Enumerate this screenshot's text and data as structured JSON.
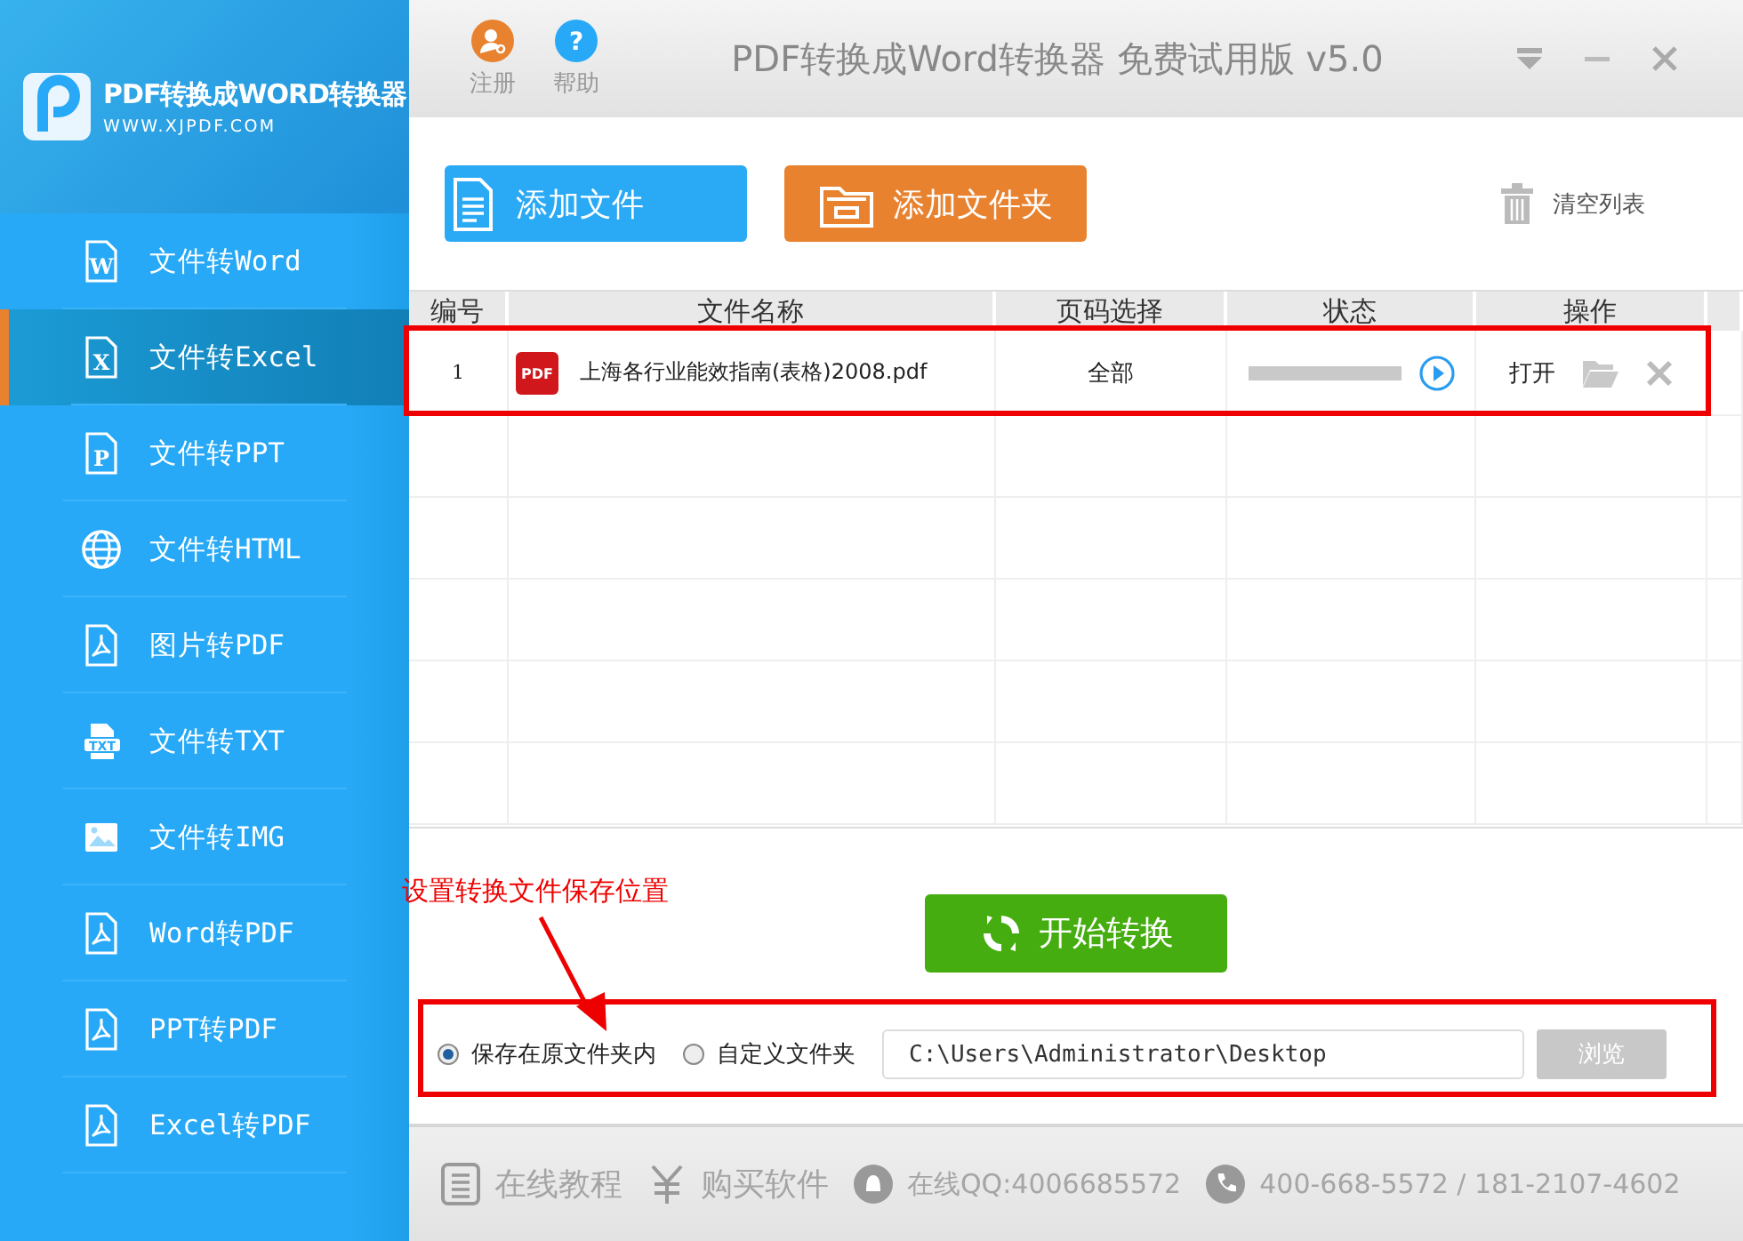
{
  "logo": {
    "title": "PDF转换成WORD转换器",
    "url": "WWW.XJPDF.COM"
  },
  "sidebar": {
    "items": [
      {
        "label": "文件转Word",
        "kind": "word",
        "icon": "W",
        "selected": false
      },
      {
        "label": "文件转Excel",
        "kind": "excel",
        "icon": "X",
        "selected": true
      },
      {
        "label": "文件转PPT",
        "kind": "ppt",
        "icon": "P",
        "selected": false
      },
      {
        "label": "文件转HTML",
        "kind": "html",
        "selected": false
      },
      {
        "label": "图片转PDF",
        "kind": "pdf",
        "selected": false
      },
      {
        "label": "文件转TXT",
        "kind": "txt",
        "icon": "TXT",
        "selected": false
      },
      {
        "label": "文件转IMG",
        "kind": "img",
        "selected": false
      },
      {
        "label": "Word转PDF",
        "kind": "pdf",
        "selected": false
      },
      {
        "label": "PPT转PDF",
        "kind": "pdf",
        "selected": false
      },
      {
        "label": "Excel转PDF",
        "kind": "pdf",
        "selected": false
      }
    ]
  },
  "header": {
    "tools": [
      {
        "label": "注册",
        "kind": "register"
      },
      {
        "label": "帮助",
        "kind": "help",
        "icon": "?"
      }
    ],
    "title": "PDF转换成Word转换器 免费试用版 v5.0"
  },
  "toolbar": {
    "buttons": [
      {
        "label": "添加文件",
        "kind": "file"
      },
      {
        "label": "添加文件夹",
        "kind": "folder"
      }
    ],
    "clear": "清空列表"
  },
  "table": {
    "columns": [
      "编号",
      "文件名称",
      "页码选择",
      "状态",
      "操作"
    ],
    "rows": [
      {
        "index": "1",
        "icon": "PDF",
        "file": "上海各行业能效指南(表格)2008.pdf",
        "pages": "全部",
        "level": 0,
        "action": "打开"
      }
    ]
  },
  "start_button": "开始转换",
  "save": {
    "options": [
      {
        "label": "保存在原文件夹内",
        "selected": true
      },
      {
        "label": "自定义文件夹",
        "selected": false
      }
    ],
    "path": "C:\\Users\\Administrator\\Desktop",
    "browse": {
      "label": "浏览",
      "disabled": true
    }
  },
  "annotation": {
    "text": "设置转换文件保存位置"
  },
  "footer": {
    "items": [
      {
        "label": "在线教程",
        "kind": "doc"
      },
      {
        "label": "购买软件",
        "kind": "yen"
      },
      {
        "label": "在线QQ:4006685572",
        "kind": "qq"
      },
      {
        "label": "400-668-5572 / 181-2107-4602",
        "kind": "phone"
      }
    ]
  }
}
